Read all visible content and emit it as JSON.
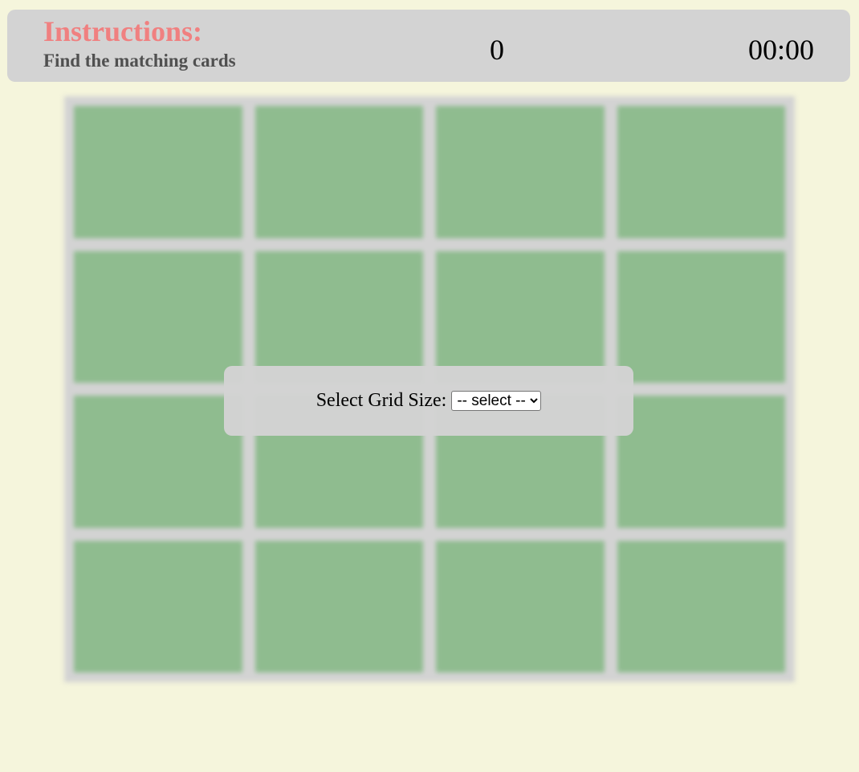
{
  "header": {
    "instructions_title": "Instructions:",
    "instructions_text": "Find the matching cards",
    "score": "0",
    "timer": "00:00"
  },
  "board": {
    "rows": 4,
    "columns": 4,
    "card_color": "#8fbc8f",
    "board_color": "#d3d3d3",
    "blurred": true
  },
  "overlay": {
    "label": "Select Grid Size:",
    "select_value": "-- select --"
  },
  "colors": {
    "background": "#f5f5dc",
    "header": "#d3d3d3",
    "title": "#f08080"
  }
}
